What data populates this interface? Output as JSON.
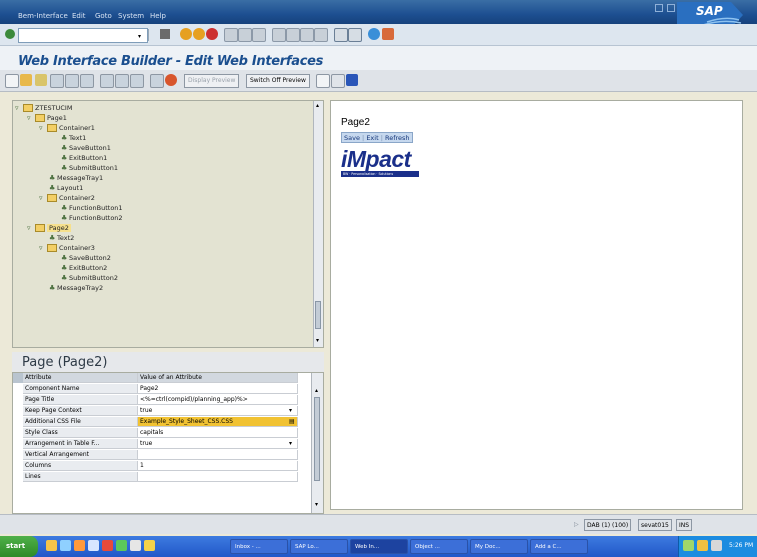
{
  "window": {
    "menu": [
      "Bem-Interface",
      "Edit",
      "Goto",
      "System",
      "Help"
    ],
    "brand": "SAP"
  },
  "page_title": "Web Interface Builder - Edit Web Interfaces",
  "toolbar": {
    "display_preview_label": "Display Preview",
    "switch_off_preview_label": "Switch Off Preview"
  },
  "tree": {
    "rows": [
      "ZTESTUCIM",
      "Page1",
      "Container1",
      "Text1",
      "SaveButton1",
      "ExitButton1",
      "SubmitButton1",
      "MessageTray1",
      "Layout1",
      "Container2",
      "FunctionButton1",
      "FunctionButton2",
      "Page2",
      "Text2",
      "Container3",
      "SaveButton2",
      "ExitButton2",
      "SubmitButton2",
      "MessageTray2"
    ]
  },
  "properties": {
    "title": "Page (Page2)",
    "header": {
      "attribute": "Attribute",
      "value": "Value of an Attribute"
    },
    "rows": [
      {
        "name": "Component Name",
        "value": "Page2"
      },
      {
        "name": "Page Title",
        "value": "<%=ctrl(compid)/planning_app)%>"
      },
      {
        "name": "Keep Page Context",
        "value": "true"
      },
      {
        "name": "Additional CSS File",
        "value": "Example_Style_Sheet_CSS.CSS"
      },
      {
        "name": "Style Class",
        "value": "capitals"
      },
      {
        "name": "Arrangement in Table F...",
        "value": "true"
      },
      {
        "name": "Vertical Arrangement",
        "value": ""
      },
      {
        "name": "Columns",
        "value": "1"
      },
      {
        "name": "Lines",
        "value": ""
      }
    ]
  },
  "preview": {
    "page_label": "Page2",
    "buttons": [
      "Save",
      "Exit",
      "Refresh"
    ],
    "logo_text": "iMpact",
    "logo_tagline": "BW · Personalisation · Solutions"
  },
  "statusbar": {
    "system": "DAB (1) (100)",
    "server": "sevat015",
    "mode": "INS"
  },
  "taskbar": {
    "start": "start",
    "buttons": [
      "Inbox - ...",
      "SAP Lo...",
      "Web In...",
      "Object ...",
      "My Doc...",
      "Add a C..."
    ],
    "clock": "5:26 PM"
  },
  "colors": {
    "title_blue": "#1b4f8f",
    "highlight_yellow": "#f1c232",
    "logo_blue": "#1a2f8a"
  }
}
